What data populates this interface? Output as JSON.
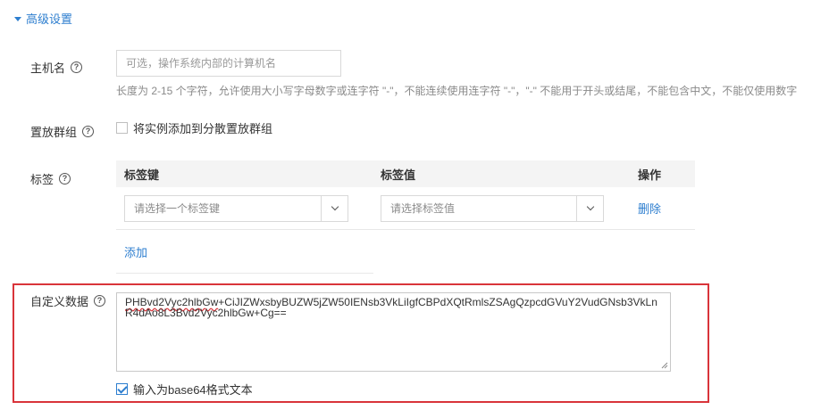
{
  "section": {
    "title": "高级设置"
  },
  "hostname": {
    "label": "主机名",
    "placeholder": "可选，操作系统内部的计算机名",
    "hint": "长度为 2-15 个字符，允许使用大小写字母数字或连字符 \"-\"，不能连续使用连字符 \"-\"，\"-\" 不能用于开头或结尾，不能包含中文，不能仅使用数字"
  },
  "placement": {
    "label": "置放群组",
    "checkbox_label": "将实例添加到分散置放群组",
    "checked": false
  },
  "tags": {
    "label": "标签",
    "columns": [
      "标签键",
      "标签值",
      "操作"
    ],
    "rows": [
      {
        "key_placeholder": "请选择一个标签键",
        "value_placeholder": "请选择标签值",
        "action": "删除"
      }
    ],
    "add_label": "添加"
  },
  "user_data": {
    "label": "自定义数据",
    "value_underlined": "PHBvd2Vyc2hlbGw",
    "value_rest": "+CiJIZWxsbyBUZW5jZW50IENsb3VkLiIgfCBPdXQtRmlsZSAgQzpcdGVuY2VudGNsb3VkLnR4dAo8L3Bvd2Vyc2hlbGw+Cg==",
    "base64_label": "输入为base64格式文本",
    "base64_checked": true
  },
  "colors": {
    "link": "#2d7ecf",
    "highlight": "#d9343a"
  },
  "icons": {
    "help": "help-circle-icon",
    "dropdown": "chevron-down-icon",
    "collapse": "triangle-down-icon"
  }
}
